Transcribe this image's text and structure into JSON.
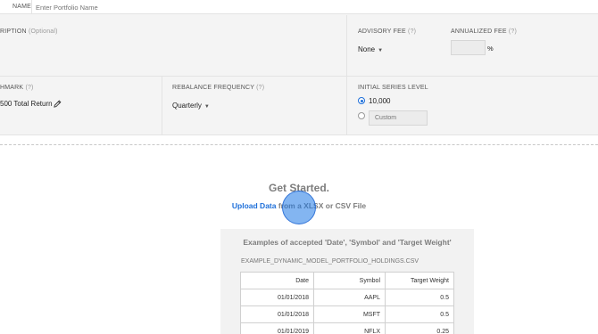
{
  "name_row": {
    "label": "NAME",
    "placeholder": "Enter Portfolio Name"
  },
  "description": {
    "label_fragment": "RIPTION",
    "optional": "(Optional)"
  },
  "advisory_fee": {
    "label": "ADVISORY FEE",
    "help": "(?)",
    "value": "None"
  },
  "annualized_fee": {
    "label": "ANNUALIZED FEE",
    "help": "(?)",
    "value": "",
    "unit": "%"
  },
  "benchmark": {
    "label_fragment": "HMARK",
    "help": "(?)",
    "value": "500 Total Return"
  },
  "rebalance": {
    "label": "REBALANCE FREQUENCY",
    "help": "(?)",
    "value": "Quarterly"
  },
  "initial_series": {
    "label": "INITIAL SERIES LEVEL",
    "option_default": "10,000",
    "option_custom_placeholder": "Custom",
    "selected": "10,000"
  },
  "get_started": {
    "title": "Get Started.",
    "upload_link": "Upload Data",
    "upload_rest": " from a XLSX or CSV File"
  },
  "examples": {
    "title": "Examples of accepted 'Date', 'Symbol' and 'Target Weight'",
    "filename": "EXAMPLE_DYNAMIC_MODEL_PORTFOLIO_HOLDINGS.CSV",
    "headers": [
      "Date",
      "Symbol",
      "Target Weight"
    ],
    "rows": [
      [
        "01/01/2018",
        "AAPL",
        "0.5"
      ],
      [
        "01/01/2018",
        "MSFT",
        "0.5"
      ],
      [
        "01/01/2019",
        "NFLX",
        "0.25"
      ]
    ]
  },
  "icons": {
    "edit": "pencil-icon",
    "dropdown": "caret-down-icon"
  },
  "colors": {
    "accent": "#1e6fd9",
    "panel_bg": "#f4f4f4"
  }
}
